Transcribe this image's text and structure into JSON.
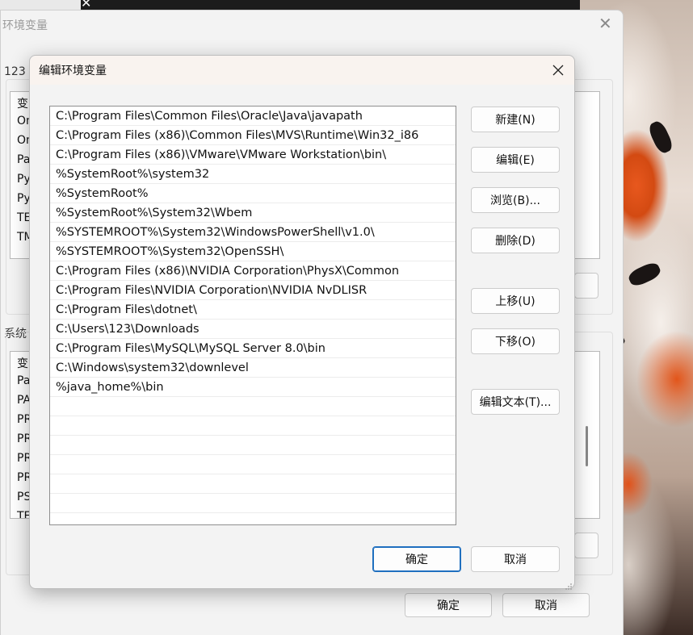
{
  "back_dialog": {
    "title_fragment": "环境变量",
    "user_section_label": "123 I",
    "user_rows": [
      "变",
      "On",
      "On",
      "Pa",
      "Py",
      "Py",
      "TE",
      "TM"
    ],
    "system_section_label": "系统",
    "system_rows": [
      "变",
      "Pa",
      "PA",
      "PR",
      "PR",
      "PR",
      "PR",
      "PS",
      "TE"
    ],
    "ok_label": "确定",
    "cancel_label": "取消"
  },
  "dialog": {
    "title": "编辑环境变量",
    "paths": [
      "C:\\Program Files\\Common Files\\Oracle\\Java\\javapath",
      "C:\\Program Files (x86)\\Common Files\\MVS\\Runtime\\Win32_i86",
      "C:\\Program Files (x86)\\VMware\\VMware Workstation\\bin\\",
      "%SystemRoot%\\system32",
      "%SystemRoot%",
      "%SystemRoot%\\System32\\Wbem",
      "%SYSTEMROOT%\\System32\\WindowsPowerShell\\v1.0\\",
      "%SYSTEMROOT%\\System32\\OpenSSH\\",
      "C:\\Program Files (x86)\\NVIDIA Corporation\\PhysX\\Common",
      "C:\\Program Files\\NVIDIA Corporation\\NVIDIA NvDLISR",
      "C:\\Program Files\\dotnet\\",
      "C:\\Users\\123\\Downloads",
      "C:\\Program Files\\MySQL\\MySQL Server 8.0\\bin",
      "C:\\Windows\\system32\\downlevel",
      "%java_home%\\bin",
      "",
      "",
      "",
      "",
      "",
      "",
      ""
    ],
    "buttons": {
      "new": "新建(N)",
      "edit": "编辑(E)",
      "browse": "浏览(B)...",
      "delete": "删除(D)",
      "move_up": "上移(U)",
      "move_down": "下移(O)",
      "edit_text": "编辑文本(T)...",
      "ok": "确定",
      "cancel": "取消"
    }
  },
  "colors": {
    "accent": "#1f6fbf",
    "dialog_bg": "#f3f3f3",
    "titlebar_bg": "#f9f3ef"
  }
}
